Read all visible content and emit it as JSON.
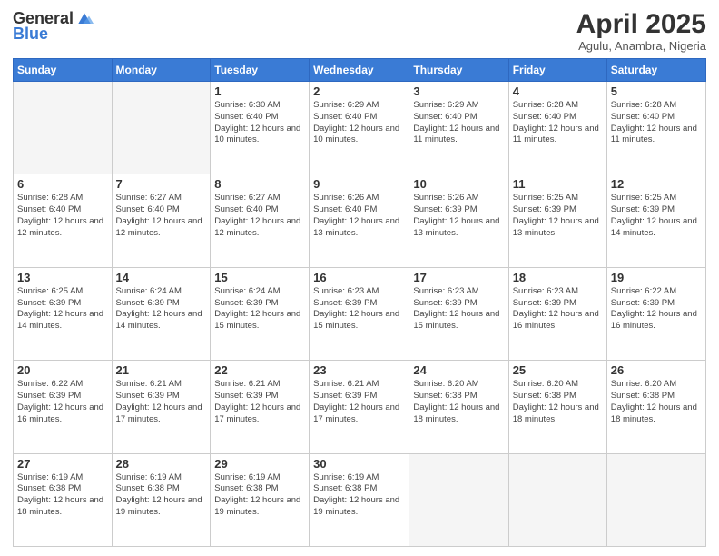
{
  "header": {
    "logo_general": "General",
    "logo_blue": "Blue",
    "month_title": "April 2025",
    "subtitle": "Agulu, Anambra, Nigeria"
  },
  "days_of_week": [
    "Sunday",
    "Monday",
    "Tuesday",
    "Wednesday",
    "Thursday",
    "Friday",
    "Saturday"
  ],
  "weeks": [
    [
      {
        "day": "",
        "info": ""
      },
      {
        "day": "",
        "info": ""
      },
      {
        "day": "1",
        "info": "Sunrise: 6:30 AM\nSunset: 6:40 PM\nDaylight: 12 hours and 10 minutes."
      },
      {
        "day": "2",
        "info": "Sunrise: 6:29 AM\nSunset: 6:40 PM\nDaylight: 12 hours and 10 minutes."
      },
      {
        "day": "3",
        "info": "Sunrise: 6:29 AM\nSunset: 6:40 PM\nDaylight: 12 hours and 11 minutes."
      },
      {
        "day": "4",
        "info": "Sunrise: 6:28 AM\nSunset: 6:40 PM\nDaylight: 12 hours and 11 minutes."
      },
      {
        "day": "5",
        "info": "Sunrise: 6:28 AM\nSunset: 6:40 PM\nDaylight: 12 hours and 11 minutes."
      }
    ],
    [
      {
        "day": "6",
        "info": "Sunrise: 6:28 AM\nSunset: 6:40 PM\nDaylight: 12 hours and 12 minutes."
      },
      {
        "day": "7",
        "info": "Sunrise: 6:27 AM\nSunset: 6:40 PM\nDaylight: 12 hours and 12 minutes."
      },
      {
        "day": "8",
        "info": "Sunrise: 6:27 AM\nSunset: 6:40 PM\nDaylight: 12 hours and 12 minutes."
      },
      {
        "day": "9",
        "info": "Sunrise: 6:26 AM\nSunset: 6:40 PM\nDaylight: 12 hours and 13 minutes."
      },
      {
        "day": "10",
        "info": "Sunrise: 6:26 AM\nSunset: 6:39 PM\nDaylight: 12 hours and 13 minutes."
      },
      {
        "day": "11",
        "info": "Sunrise: 6:25 AM\nSunset: 6:39 PM\nDaylight: 12 hours and 13 minutes."
      },
      {
        "day": "12",
        "info": "Sunrise: 6:25 AM\nSunset: 6:39 PM\nDaylight: 12 hours and 14 minutes."
      }
    ],
    [
      {
        "day": "13",
        "info": "Sunrise: 6:25 AM\nSunset: 6:39 PM\nDaylight: 12 hours and 14 minutes."
      },
      {
        "day": "14",
        "info": "Sunrise: 6:24 AM\nSunset: 6:39 PM\nDaylight: 12 hours and 14 minutes."
      },
      {
        "day": "15",
        "info": "Sunrise: 6:24 AM\nSunset: 6:39 PM\nDaylight: 12 hours and 15 minutes."
      },
      {
        "day": "16",
        "info": "Sunrise: 6:23 AM\nSunset: 6:39 PM\nDaylight: 12 hours and 15 minutes."
      },
      {
        "day": "17",
        "info": "Sunrise: 6:23 AM\nSunset: 6:39 PM\nDaylight: 12 hours and 15 minutes."
      },
      {
        "day": "18",
        "info": "Sunrise: 6:23 AM\nSunset: 6:39 PM\nDaylight: 12 hours and 16 minutes."
      },
      {
        "day": "19",
        "info": "Sunrise: 6:22 AM\nSunset: 6:39 PM\nDaylight: 12 hours and 16 minutes."
      }
    ],
    [
      {
        "day": "20",
        "info": "Sunrise: 6:22 AM\nSunset: 6:39 PM\nDaylight: 12 hours and 16 minutes."
      },
      {
        "day": "21",
        "info": "Sunrise: 6:21 AM\nSunset: 6:39 PM\nDaylight: 12 hours and 17 minutes."
      },
      {
        "day": "22",
        "info": "Sunrise: 6:21 AM\nSunset: 6:39 PM\nDaylight: 12 hours and 17 minutes."
      },
      {
        "day": "23",
        "info": "Sunrise: 6:21 AM\nSunset: 6:39 PM\nDaylight: 12 hours and 17 minutes."
      },
      {
        "day": "24",
        "info": "Sunrise: 6:20 AM\nSunset: 6:38 PM\nDaylight: 12 hours and 18 minutes."
      },
      {
        "day": "25",
        "info": "Sunrise: 6:20 AM\nSunset: 6:38 PM\nDaylight: 12 hours and 18 minutes."
      },
      {
        "day": "26",
        "info": "Sunrise: 6:20 AM\nSunset: 6:38 PM\nDaylight: 12 hours and 18 minutes."
      }
    ],
    [
      {
        "day": "27",
        "info": "Sunrise: 6:19 AM\nSunset: 6:38 PM\nDaylight: 12 hours and 18 minutes."
      },
      {
        "day": "28",
        "info": "Sunrise: 6:19 AM\nSunset: 6:38 PM\nDaylight: 12 hours and 19 minutes."
      },
      {
        "day": "29",
        "info": "Sunrise: 6:19 AM\nSunset: 6:38 PM\nDaylight: 12 hours and 19 minutes."
      },
      {
        "day": "30",
        "info": "Sunrise: 6:19 AM\nSunset: 6:38 PM\nDaylight: 12 hours and 19 minutes."
      },
      {
        "day": "",
        "info": ""
      },
      {
        "day": "",
        "info": ""
      },
      {
        "day": "",
        "info": ""
      }
    ]
  ]
}
